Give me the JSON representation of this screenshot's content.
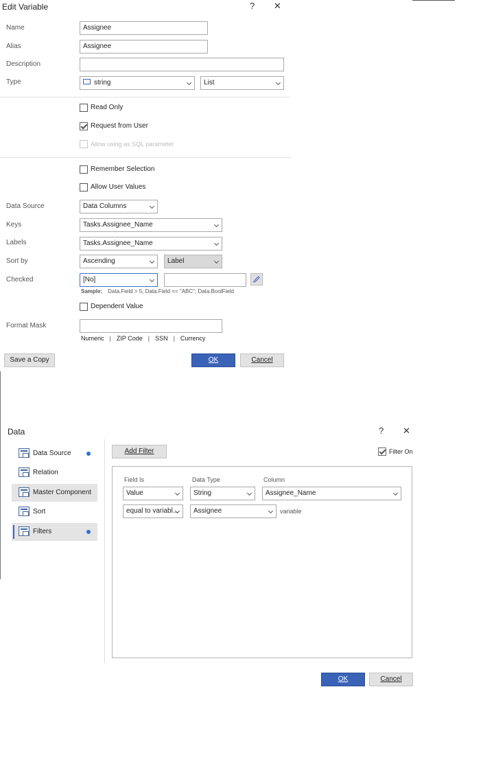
{
  "edit_variable": {
    "title": "Edit Variable",
    "help_icon": "?",
    "close_icon": "✕",
    "labels": {
      "name": "Name",
      "alias": "Alias",
      "description": "Description",
      "type": "Type",
      "data_source": "Data Source",
      "keys": "Keys",
      "labels": "Labels",
      "sort_by": "Sort by",
      "checked": "Checked",
      "format_mask": "Format Mask"
    },
    "name_value": "Assignee",
    "alias_value": "Assignee",
    "description_value": "",
    "type_value": "string",
    "type_icon": "string-type-icon",
    "type_kind_value": "List",
    "read_only": {
      "label": "Read Only",
      "checked": false
    },
    "request_from_user": {
      "label": "Request from User",
      "checked": true
    },
    "allow_sql": {
      "label": "Allow using as SQL parameter",
      "checked": false,
      "disabled": true
    },
    "remember_selection": {
      "label": "Remember Selection",
      "checked": false
    },
    "allow_user_values": {
      "label": "Allow User Values",
      "checked": false
    },
    "data_source_value": "Data Columns",
    "keys_value": "Tasks.Assignee_Name",
    "labels_value": "Tasks.Assignee_Name",
    "sort_by_value": "Ascending",
    "sort_by_field_value": "Label",
    "checked_value": "[No]",
    "checked_expression": "",
    "sample_label": "Sample:",
    "sample_text": "Data.Field > 5; Data.Field == \"ABC\"; Data.BoolField",
    "dependent_value": {
      "label": "Dependent Value",
      "checked": false
    },
    "format_mask_value": "",
    "mask_options": [
      "Numeric",
      "ZIP Code",
      "SSN",
      "Currency"
    ],
    "save_copy_label": "Save a Copy",
    "ok_label": "OK",
    "cancel_label": "Cancel"
  },
  "data_dialog": {
    "title": "Data",
    "help_icon": "?",
    "close_icon": "✕",
    "nav": [
      {
        "label": "Data Source",
        "icon": "data-source-icon",
        "has_dot": true,
        "active": false
      },
      {
        "label": "Relation",
        "icon": "relation-icon",
        "has_dot": false,
        "active": false
      },
      {
        "label": "Master Component",
        "icon": "master-component-icon",
        "has_dot": false,
        "active": true
      },
      {
        "label": "Sort",
        "icon": "sort-icon",
        "has_dot": false,
        "active": false
      },
      {
        "label": "Filters",
        "icon": "filters-icon",
        "has_dot": true,
        "active": true
      }
    ],
    "add_filter_label": "Add Filter",
    "filter_on": {
      "label": "Filter On",
      "checked": true
    },
    "columns": {
      "field_is": "Field Is",
      "data_type": "Data Type",
      "column": "Column"
    },
    "row1": {
      "field_is": "Value",
      "data_type": "String",
      "column": "Assignee_Name"
    },
    "row2": {
      "condition": "equal to variabl...",
      "variable": "Assignee",
      "suffix": "variable"
    },
    "ok_label": "OK",
    "cancel_label": "Cancel"
  },
  "colors": {
    "accent": "#3a63b8",
    "dot": "#2f6fd1",
    "button_gray": "#e2e2e2"
  }
}
